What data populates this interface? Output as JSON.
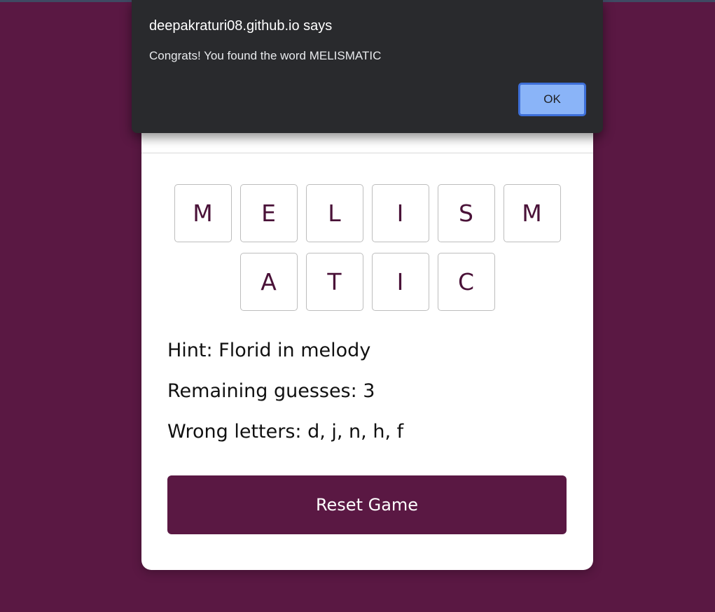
{
  "dialog": {
    "title": "deepakraturi08.github.io says",
    "message": "Congrats! You found the word MELISMATIC",
    "ok_label": "OK"
  },
  "game": {
    "row1": [
      "M",
      "E",
      "L",
      "I",
      "S",
      "M"
    ],
    "row2": [
      "A",
      "T",
      "I",
      "C"
    ],
    "hint": "Hint: Florid in melody",
    "remaining": "Remaining guesses: 3",
    "wrong": "Wrong letters: d, j, n, h, f",
    "reset_label": "Reset Game"
  },
  "colors": {
    "background": "#5a1843",
    "letter": "#4a1238",
    "dialog_bg": "#292a2d",
    "ok_button": "#8ab4f8"
  }
}
